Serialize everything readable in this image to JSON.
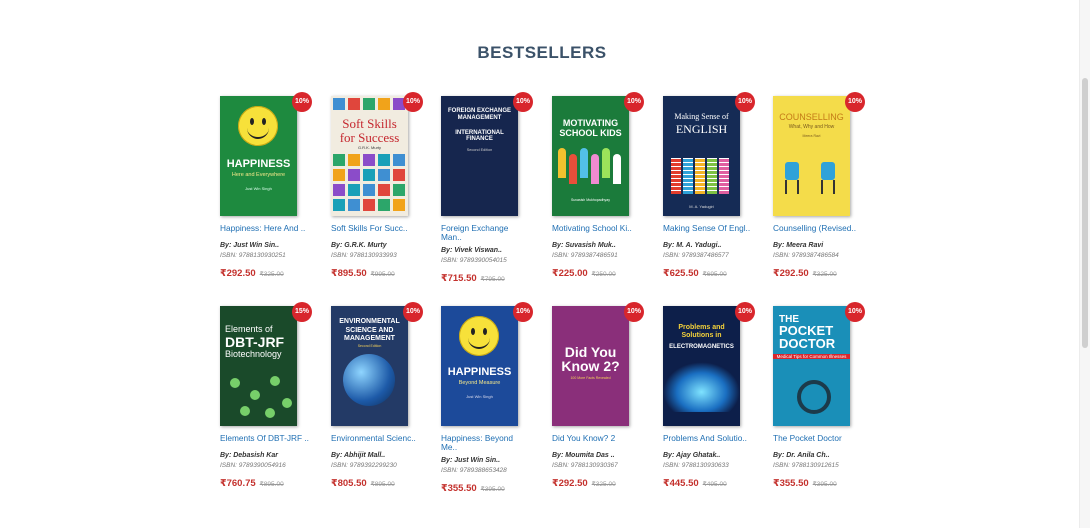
{
  "section": {
    "heading": "BESTSELLERS"
  },
  "books": [
    {
      "title": "Happiness: Here And ..",
      "author": "By: Just Win Sin..",
      "isbn": "ISBN: 9788130930251",
      "price": "₹292.50",
      "old_price": "₹325.00",
      "discount": "10%",
      "cover": {
        "bg": "#1e8a3f",
        "l1": "HAPPINESS",
        "l2": "Here and Everywhere",
        "l3": "Just Win Singh"
      }
    },
    {
      "title": "Soft Skills For Succ..",
      "author": "By: G.R.K. Murty",
      "isbn": "ISBN: 9788130933993",
      "price": "₹895.50",
      "old_price": "₹995.00",
      "discount": "10%",
      "cover": {
        "bg": "#f1ece0",
        "l1": "Soft Skills",
        "l2": "for Success",
        "l3": "G.R.K. Murty"
      }
    },
    {
      "title": "Foreign Exchange Man..",
      "author": "By: Vivek Viswan..",
      "isbn": "ISBN: 9789390054015",
      "price": "₹715.50",
      "old_price": "₹795.00",
      "discount": "10%",
      "cover": {
        "bg": "#16264e",
        "l1": "FOREIGN EXCHANGE MANAGEMENT",
        "l2": "INTERNATIONAL FINANCE",
        "l3": "Second Edition"
      }
    },
    {
      "title": "Motivating School Ki..",
      "author": "By: Suvasish Muk..",
      "isbn": "ISBN: 9789387486591",
      "price": "₹225.00",
      "old_price": "₹250.00",
      "discount": "10%",
      "cover": {
        "bg": "#1b7b3b",
        "l1": "MOTIVATING",
        "l2": "SCHOOL KIDS",
        "l3": "Suvasish Mukhopadhyay"
      }
    },
    {
      "title": "Making Sense Of Engl..",
      "author": "By: M. A. Yadugi..",
      "isbn": "ISBN: 9789387486577",
      "price": "₹625.50",
      "old_price": "₹695.00",
      "discount": "10%",
      "cover": {
        "bg": "#152b55",
        "l1": "Making Sense of",
        "l2": "ENGLISH",
        "l3": "M. A. Yadugiri"
      }
    },
    {
      "title": "Counselling (Revised..",
      "author": "By: Meera Ravi",
      "isbn": "ISBN: 9789387486584",
      "price": "₹292.50",
      "old_price": "₹325.00",
      "discount": "10%",
      "cover": {
        "bg": "#f4dc4a",
        "l1": "COUNSELLING",
        "l2": "What, Why and How",
        "l3": "Meera Ravi"
      }
    },
    {
      "title": "Elements Of DBT-JRF ..",
      "author": "By: Debasish Kar",
      "isbn": "ISBN: 9789390054916",
      "price": "₹760.75",
      "old_price": "₹895.00",
      "discount": "15%",
      "cover": {
        "bg": "#1a4a2a",
        "l1": "Elements of",
        "l2": "DBT-JRF",
        "l3": "Biotechnology"
      }
    },
    {
      "title": "Environmental Scienc..",
      "author": "By: Abhijit Mall..",
      "isbn": "ISBN: 9789392299230",
      "price": "₹805.50",
      "old_price": "₹895.00",
      "discount": "10%",
      "cover": {
        "bg": "#233a66",
        "l1": "ENVIRONMENTAL",
        "l2": "SCIENCE AND MANAGEMENT",
        "l3": "Second Edition"
      }
    },
    {
      "title": "Happiness: Beyond Me..",
      "author": "By: Just Win Sin..",
      "isbn": "ISBN: 9789388653428",
      "price": "₹355.50",
      "old_price": "₹395.00",
      "discount": "10%",
      "cover": {
        "bg": "#1c4a9a",
        "l1": "HAPPINESS",
        "l2": "Beyond Measure",
        "l3": "Just Win Singh"
      }
    },
    {
      "title": "Did You Know? 2",
      "author": "By: Moumita Das ..",
      "isbn": "ISBN: 9788130930367",
      "price": "₹292.50",
      "old_price": "₹325.00",
      "discount": "10%",
      "cover": {
        "bg": "#8a2f7a",
        "l1": "Did You",
        "l2": "Know 2?",
        "l3": "100 More Facts Revealed"
      }
    },
    {
      "title": "Problems And Solutio..",
      "author": "By: Ajay Ghatak..",
      "isbn": "ISBN: 9788130930633",
      "price": "₹445.50",
      "old_price": "₹495.00",
      "discount": "10%",
      "cover": {
        "bg": "#0d1f4a",
        "l1": "Problems and Solutions in",
        "l2": "ELECTROMAGNETICS",
        "l3": ""
      }
    },
    {
      "title": "The Pocket Doctor",
      "author": "By: Dr. Anila Ch..",
      "isbn": "ISBN: 9788130912615",
      "price": "₹355.50",
      "old_price": "₹395.00",
      "discount": "10%",
      "cover": {
        "bg": "#1a8fb8",
        "l1": "THE",
        "l2": "POCKET DOCTOR",
        "l3": "Medical Tips for Common Illnesses"
      }
    }
  ]
}
